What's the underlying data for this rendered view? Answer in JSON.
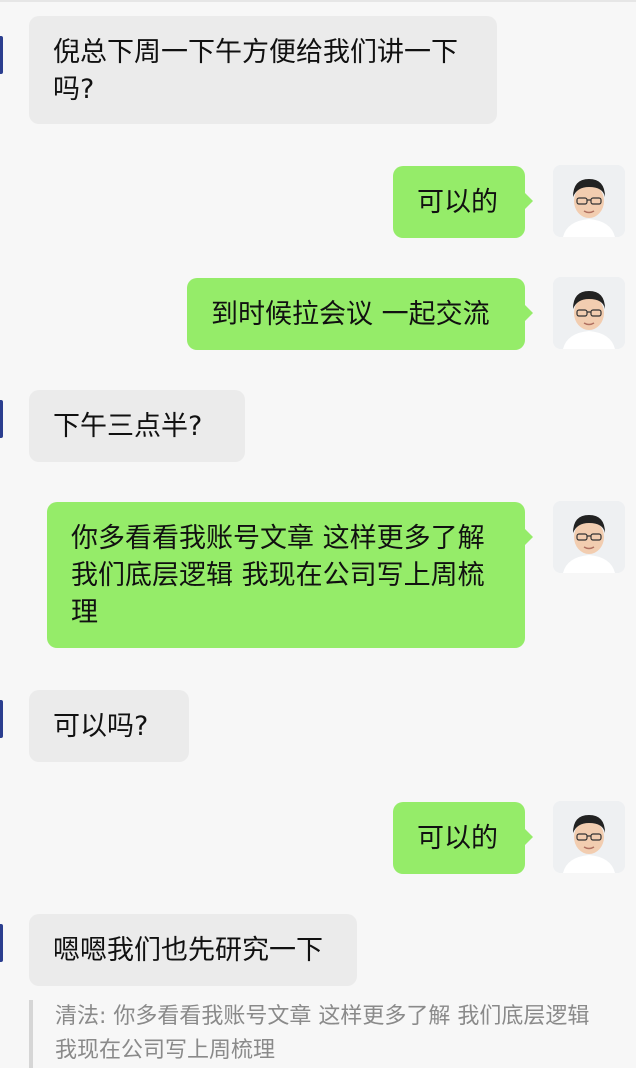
{
  "messages": [
    {
      "side": "left",
      "text": "倪总下周一下午方便给我们讲一下吗?"
    },
    {
      "side": "right",
      "text": "可以的"
    },
    {
      "side": "right",
      "text": "到时候拉会议 一起交流"
    },
    {
      "side": "left",
      "text": "下午三点半?"
    },
    {
      "side": "right",
      "text": "你多看看我账号文章 这样更多了解我们底层逻辑 我现在公司写上周梳理"
    },
    {
      "side": "left",
      "text": "可以吗?"
    },
    {
      "side": "right",
      "text": "可以的"
    },
    {
      "side": "left",
      "text": "嗯嗯我们也先研究一下"
    }
  ],
  "quote": {
    "text": "清法: 你多看看我账号文章 这样更多了解 我们底层逻辑 我现在公司写上周梳理"
  },
  "colors": {
    "sent_bubble": "#95ec69",
    "received_bubble": "#ebebeb",
    "background": "#f7f7f7"
  }
}
